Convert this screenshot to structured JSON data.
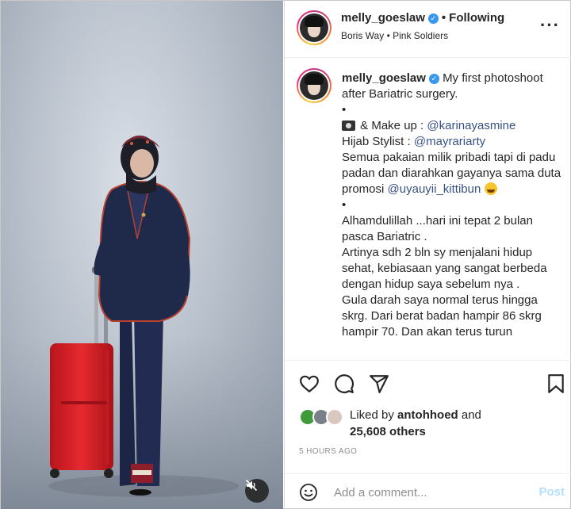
{
  "post": {
    "username": "melly_goeslaw",
    "verified": true,
    "follow_status": "Following",
    "audio": "Boris Way • Pink Soldiers",
    "more_icon": "more-horizontal-icon"
  },
  "caption": {
    "username": "melly_goeslaw",
    "line1": "My first photoshoot after Bariatric surgery.",
    "bullet": "•",
    "makeup_label": "& Make up :",
    "makeup_mention": "@karinayasmine",
    "hijab_label": "Hijab Stylist :",
    "hijab_mention": "@mayrariarty",
    "para1": "Semua pakaian milik pribadi tapi di padu padan dan diarahkan gayanya sama duta promosi",
    "promo_mention": "@uyauyii_kittibun",
    "para2": "Alhamdulillah ...hari ini tepat 2 bulan pasca Bariatric .",
    "para3": "Artinya sdh 2 bln sy menjalani hidup sehat, kebiasaan yang sangat berbeda dengan hidup saya sebelum nya .",
    "para4": "Gula darah saya normal terus hingga skrg. Dari berat badan hampir 86 skrg hampir 70. Dan akan terus turun"
  },
  "likes": {
    "liked_by_prefix": "Liked by",
    "liked_by_user": "antohhoed",
    "and": "and",
    "others": "25,608 others"
  },
  "timestamp": "5 HOURS AGO",
  "comment": {
    "placeholder": "Add a comment...",
    "post_label": "Post"
  },
  "colors": {
    "mention": "#385185",
    "post_disabled": "#b2dffc",
    "suitcase": "#e0262c",
    "suit": "#1f2a4a"
  }
}
